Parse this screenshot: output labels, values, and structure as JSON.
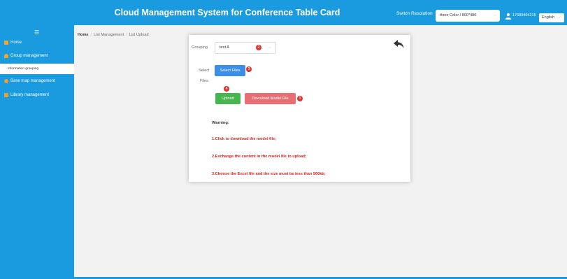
{
  "header": {
    "title": "Cloud Management System for Conference Table Card",
    "switch_resolution_label": "Switch Resolution",
    "resolution_value": "three Color / 800*480",
    "user_phone": "17680404215",
    "language": "English"
  },
  "sidebar": {
    "items": [
      {
        "label": "Home",
        "icon": "home-icon",
        "color": "#f5a623"
      },
      {
        "label": "Group management",
        "icon": "user-icon",
        "color": "#f5a623"
      },
      {
        "label": "Information grouping"
      },
      {
        "label": "Base map management",
        "icon": "sun-icon",
        "color": "#f0a030"
      },
      {
        "label": "Library management",
        "icon": "book-icon",
        "color": "#f0a030"
      }
    ]
  },
  "breadcrumb": {
    "home": "Home",
    "sep": "/",
    "list": "List Management",
    "current": "List Upload"
  },
  "form": {
    "grouping_label": "Grouping",
    "grouping_value": "test A",
    "select_label": "Select",
    "files_label": "Files",
    "select_files_button": "Select Files",
    "upload_button": "Upload",
    "download_button": "Download Model File",
    "badges": [
      "2",
      "3",
      "4",
      "1"
    ]
  },
  "warning": {
    "title": "Warning:",
    "lines": [
      "1.Click to download the model file;",
      "2.Exchange the content in the model file to upload;",
      "3.Choose the Excel file and the size must be less than 500kb;"
    ]
  },
  "colors": {
    "primary": "#1a9be0",
    "select_button": "#3c8ee6",
    "upload_button": "#47b550",
    "download_button": "#e86e73",
    "badge": "#e5332a",
    "warning_text": "#e01e1e"
  }
}
